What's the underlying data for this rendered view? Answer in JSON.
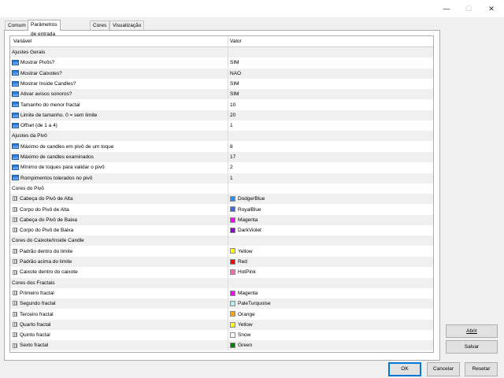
{
  "window": {
    "minimize_glyph": "—",
    "maximize_glyph": "☐",
    "close_glyph": "✕"
  },
  "tabs": [
    {
      "label": "Comum"
    },
    {
      "label": "Parâmetros de entrada"
    },
    {
      "label": "Cores"
    },
    {
      "label": "Visualização"
    }
  ],
  "grid": {
    "col_variable": "Variável",
    "col_value": "Valor",
    "rows": [
      {
        "kind": "section",
        "label": "Ajustes Gerais"
      },
      {
        "kind": "num",
        "label": "Mostrar Pivôs?",
        "value": "SIM"
      },
      {
        "kind": "num",
        "label": "Mostrar Caixotes?",
        "value": "NAO"
      },
      {
        "kind": "num",
        "label": "Mostrar Inside Candles?",
        "value": "SIM"
      },
      {
        "kind": "num",
        "label": "Ativar avisos sonoros?",
        "value": "SIM"
      },
      {
        "kind": "num",
        "label": "Tamanho do menor fractal",
        "value": "10"
      },
      {
        "kind": "num",
        "label": "Limite de tamanho. 0 = sem limite",
        "value": "20"
      },
      {
        "kind": "num",
        "label": "Offset (de 1 a 4)",
        "value": "1"
      },
      {
        "kind": "section",
        "label": "Ajustes da Pivô"
      },
      {
        "kind": "num",
        "label": "Máximo de candles em pivô de um toque",
        "value": "8"
      },
      {
        "kind": "num",
        "label": "Máximo de candles examinados",
        "value": "17"
      },
      {
        "kind": "num",
        "label": "Mínimo de toques para validar o pivô",
        "value": "2"
      },
      {
        "kind": "num",
        "label": "Rompimentos tolerados no pivô",
        "value": "1"
      },
      {
        "kind": "section",
        "label": "Cores do Pivô"
      },
      {
        "kind": "color",
        "label": "Cabeça do Pivô de Alta",
        "value": "DodgerBlue",
        "color": "#1e90ff"
      },
      {
        "kind": "color",
        "label": "Corpo do Pivô de Alta",
        "value": "RoyalBlue",
        "color": "#4169e1"
      },
      {
        "kind": "color",
        "label": "Cabeça do Pivô de Baixa",
        "value": "Magenta",
        "color": "#ff00ff"
      },
      {
        "kind": "color",
        "label": "Corpo do Pivô de Baixa",
        "value": "DarkViolet",
        "color": "#9400d3"
      },
      {
        "kind": "section",
        "label": "Cores do Caixote/Inside Candle"
      },
      {
        "kind": "color",
        "label": "Padrão dentro do limite",
        "value": "Yellow",
        "color": "#ffff00"
      },
      {
        "kind": "color",
        "label": "Padrão acima do limite",
        "value": "Red",
        "color": "#ff0000"
      },
      {
        "kind": "color",
        "label": "Caixote dentro do caixote",
        "value": "HotPink",
        "color": "#ff69b4"
      },
      {
        "kind": "section",
        "label": "Cores dos Fractais"
      },
      {
        "kind": "color",
        "label": "Primeiro fractal",
        "value": "Magenta",
        "color": "#ff00ff"
      },
      {
        "kind": "color",
        "label": "Segundo fractal",
        "value": "PaleTurquoise",
        "color": "#afeeee"
      },
      {
        "kind": "color",
        "label": "Terceiro fractal",
        "value": "Orange",
        "color": "#ffa500"
      },
      {
        "kind": "color",
        "label": "Quarto fractal",
        "value": "Yellow",
        "color": "#ffff00"
      },
      {
        "kind": "color",
        "label": "Quinto fractal",
        "value": "Snow",
        "color": "#fffafa"
      },
      {
        "kind": "color",
        "label": "Sexto fractal",
        "value": "Green",
        "color": "#008000"
      }
    ]
  },
  "side_buttons": {
    "open": "Abrir",
    "save": "Salvar"
  },
  "footer": {
    "ok": "OK",
    "cancel": "Cancelar",
    "reset": "Resetar"
  }
}
